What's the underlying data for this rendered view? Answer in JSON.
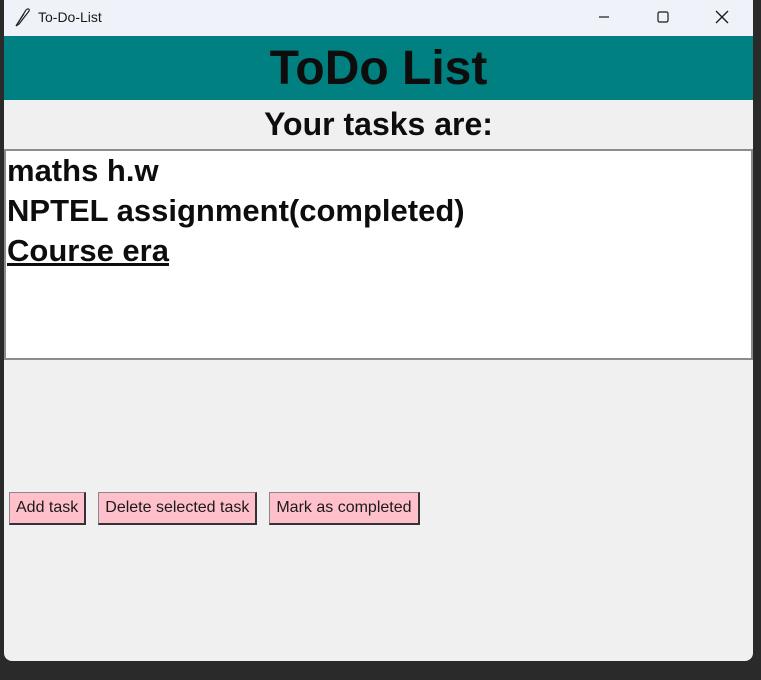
{
  "window": {
    "title": "To-Do-List",
    "icon": "feather-icon",
    "controls": [
      "minimize-icon",
      "maximize-icon",
      "close-icon"
    ]
  },
  "app": {
    "heading": "ToDo List",
    "subheading": "Your tasks are:",
    "heading_bg": "#008080",
    "button_bg": "#ffc0cb"
  },
  "tasks": [
    {
      "text": "maths h.w"
    },
    {
      "text": "NPTEL assignment(completed)"
    },
    {
      "text": "Course era"
    }
  ],
  "buttons": {
    "add": "Add task",
    "delete": "Delete selected task",
    "complete": "Mark as completed"
  }
}
